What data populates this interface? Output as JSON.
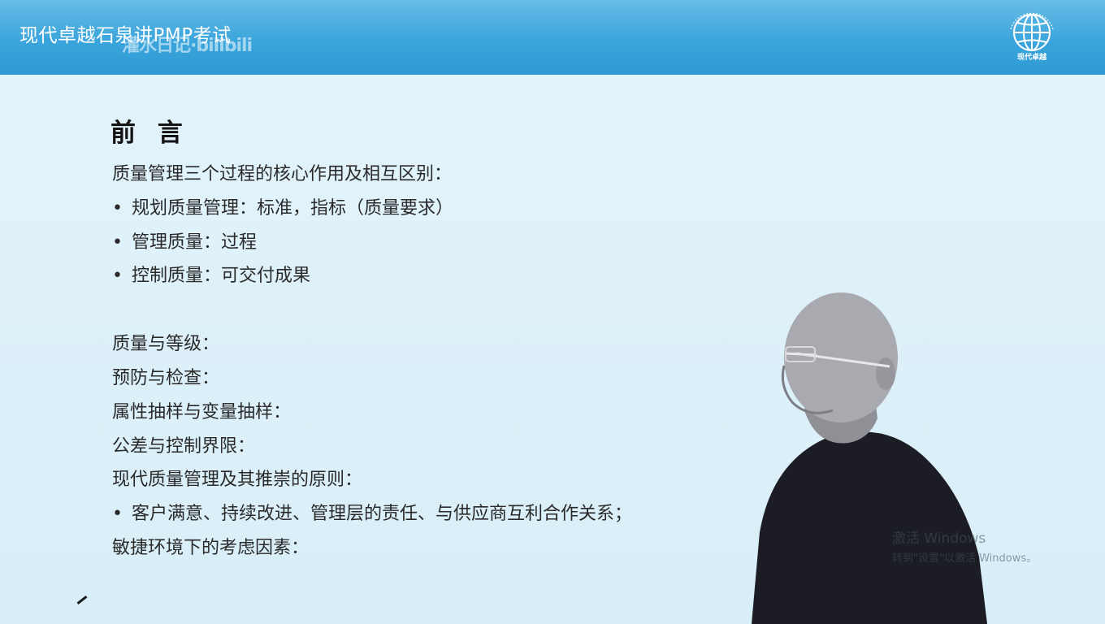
{
  "header": {
    "course_title": "现代卓越石泉讲PMP考试",
    "watermark": "灌水日记·bilibili",
    "brand_text": "现代卓越"
  },
  "slide": {
    "title": "前 言",
    "lines": [
      {
        "bullet": false,
        "text": "质量管理三个过程的核心作用及相互区别："
      },
      {
        "bullet": true,
        "text": "规划质量管理：标准，指标（质量要求）"
      },
      {
        "bullet": true,
        "text": "管理质量：过程"
      },
      {
        "bullet": true,
        "text": "控制质量：可交付成果"
      },
      {
        "bullet": false,
        "text": "质量与等级："
      },
      {
        "bullet": false,
        "text": "预防与检查："
      },
      {
        "bullet": false,
        "text": "属性抽样与变量抽样："
      },
      {
        "bullet": false,
        "text": "公差与控制界限："
      },
      {
        "bullet": false,
        "text": "现代质量管理及其推崇的原则："
      },
      {
        "bullet": true,
        "text": "客户满意、持续改进、管理层的责任、与供应商互利合作关系；"
      },
      {
        "bullet": false,
        "text": "敏捷环境下的考虑因素："
      }
    ],
    "bullet_char": "•"
  },
  "overlay": {
    "activation_title": "激活 Windows",
    "activation_sub": "转到\"设置\"以激活 Windows。"
  },
  "colors": {
    "header": "#3aa5dc",
    "background": "#dbeef6",
    "text": "#2a2a2a"
  },
  "icons": [
    "globe-logo-icon",
    "pen-cursor-icon"
  ]
}
